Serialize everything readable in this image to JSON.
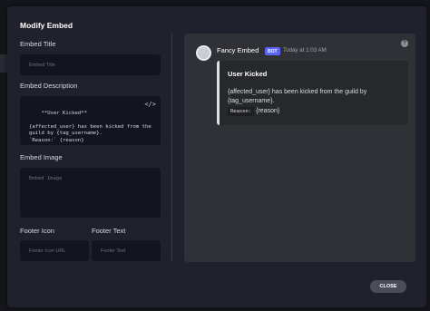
{
  "modal": {
    "title": "Modify Embed",
    "close_label": "CLOSE"
  },
  "form": {
    "title_label": "Embed Title",
    "title_placeholder": "Embed Title",
    "description_label": "Embed Description",
    "description_value": "**User Kicked**\n\n{affected_user} has been kicked from the\nguild by {tag_username}.\n`Reason:` {reason}",
    "image_label": "Embed Image",
    "image_placeholder": "Embed Image",
    "footer_icon_label": "Footer Icon",
    "footer_icon_placeholder": "Footer Icon URL",
    "footer_text_label": "Footer Text",
    "footer_text_placeholder": "Footer Text"
  },
  "preview": {
    "author": "Fancy Embed",
    "badge": "BOT",
    "timestamp": "Today at 1:03 AM",
    "embed_color": "#dfe0e3",
    "embed_title": "User Kicked",
    "line1": "{affected_user} has been kicked from the guild by",
    "line2": "{tag_username}.",
    "reason_code": "Reason:",
    "reason_value": "{reason}"
  },
  "icons": {
    "code": "code-icon",
    "help": "help-icon"
  }
}
